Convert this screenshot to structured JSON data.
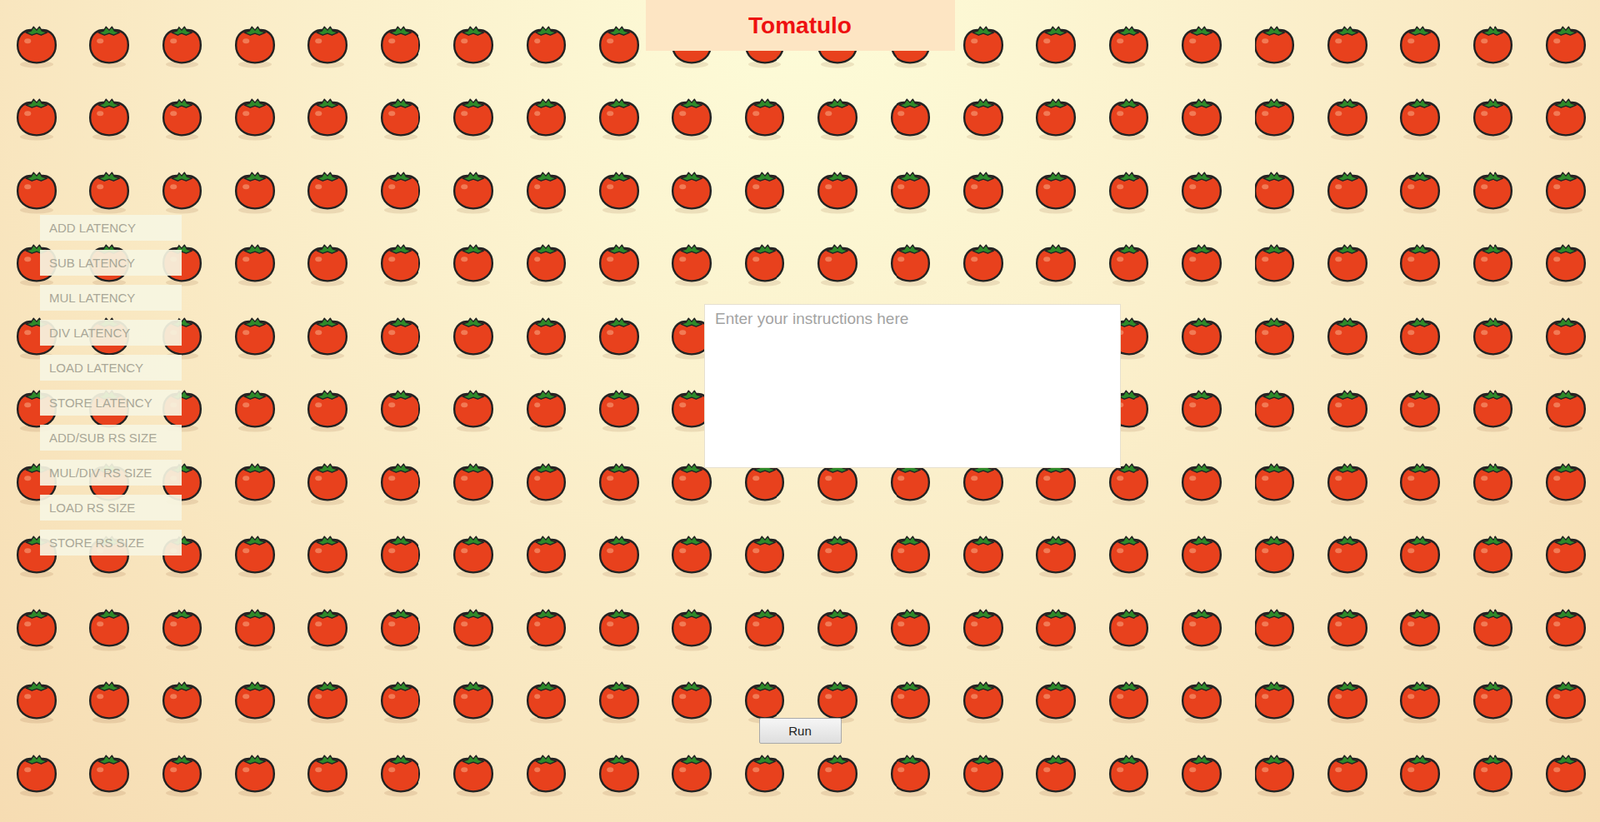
{
  "window": {
    "title": "Tomatulo"
  },
  "settings": [
    {
      "placeholder": "ADD LATENCY"
    },
    {
      "placeholder": "SUB LATENCY"
    },
    {
      "placeholder": "MUL LATENCY"
    },
    {
      "placeholder": "DIV LATENCY"
    },
    {
      "placeholder": "LOAD LATENCY"
    },
    {
      "placeholder": "STORE LATENCY"
    },
    {
      "placeholder": "ADD/SUB RS SIZE"
    },
    {
      "placeholder": "MUL/DIV RS SIZE"
    },
    {
      "placeholder": "LOAD RS SIZE"
    },
    {
      "placeholder": "STORE RS SIZE"
    }
  ],
  "instructions": {
    "placeholder": "Enter your instructions here"
  },
  "buttons": [
    "Run"
  ]
}
